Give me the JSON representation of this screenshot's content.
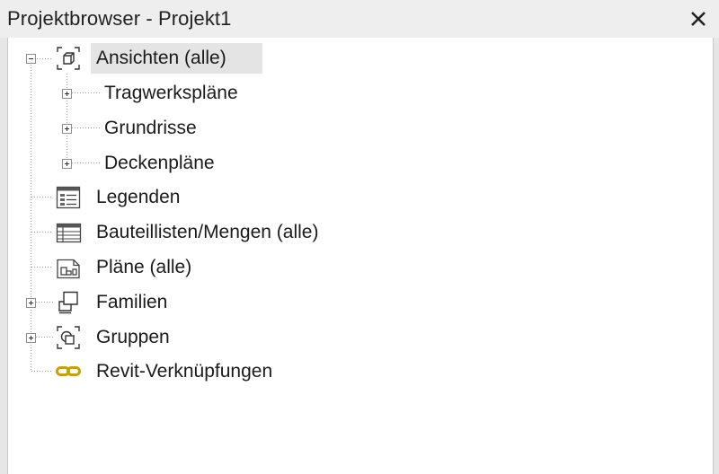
{
  "window": {
    "title": "Projektbrowser - Projekt1",
    "close_icon": "close-icon"
  },
  "tree": {
    "root": {
      "label": "Ansichten (alle)",
      "icon": "views-icon",
      "expanded": true,
      "selected": true,
      "children": [
        {
          "label": "Tragwerkspläne",
          "expander": "plus"
        },
        {
          "label": "Grundrisse",
          "expander": "plus"
        },
        {
          "label": "Deckenpläne",
          "expander": "plus"
        }
      ]
    },
    "items": [
      {
        "label": "Legenden",
        "icon": "legend-icon",
        "expander": "none"
      },
      {
        "label": "Bauteillisten/Mengen (alle)",
        "icon": "schedule-icon",
        "expander": "none"
      },
      {
        "label": "Pläne (alle)",
        "icon": "sheets-icon",
        "expander": "none"
      },
      {
        "label": "Familien",
        "icon": "families-icon",
        "expander": "plus"
      },
      {
        "label": "Gruppen",
        "icon": "groups-icon",
        "expander": "plus"
      },
      {
        "label": "Revit-Verknüpfungen",
        "icon": "revit-links-icon",
        "expander": "none"
      }
    ]
  },
  "colors": {
    "link_icon": "#c9a100",
    "selection": "#e4e4e4"
  }
}
